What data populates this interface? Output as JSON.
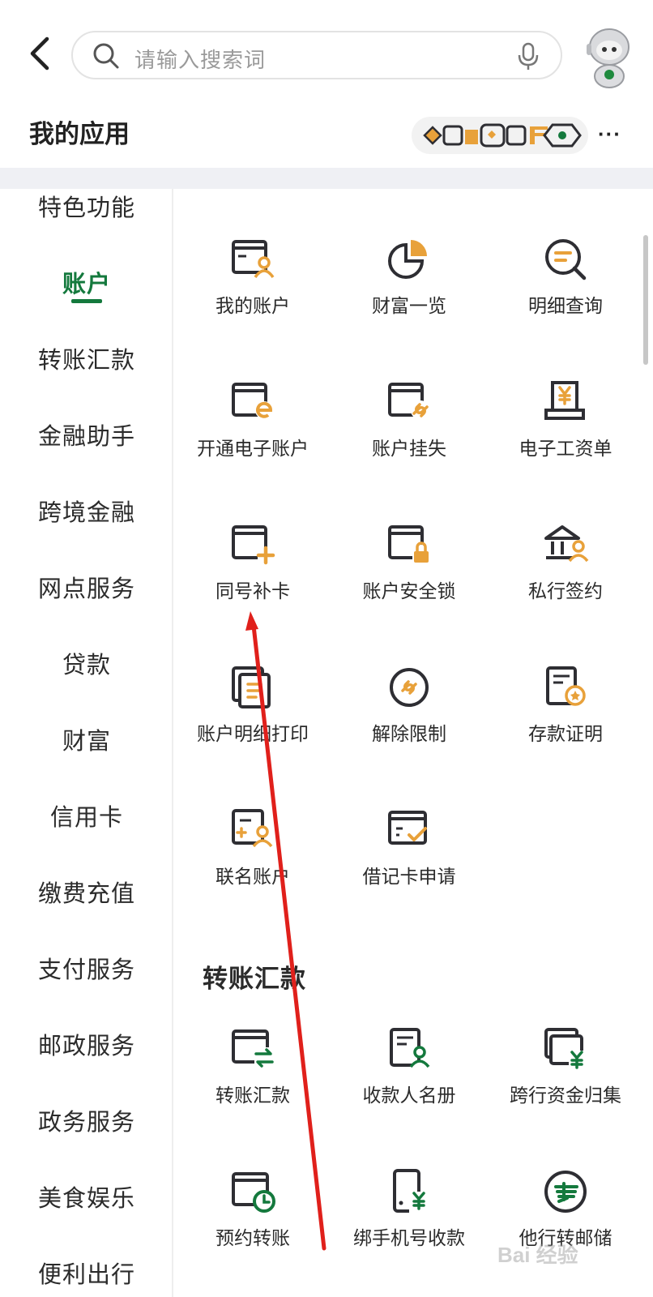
{
  "search": {
    "placeholder": "请输入搜索词"
  },
  "header": {
    "section_title": "我的应用",
    "more_label": "···"
  },
  "sidebar": {
    "items": [
      {
        "label": "特色功能"
      },
      {
        "label": "账户"
      },
      {
        "label": "转账汇款"
      },
      {
        "label": "金融助手"
      },
      {
        "label": "跨境金融"
      },
      {
        "label": "网点服务"
      },
      {
        "label": "贷款"
      },
      {
        "label": "财富"
      },
      {
        "label": "信用卡"
      },
      {
        "label": "缴费充值"
      },
      {
        "label": "支付服务"
      },
      {
        "label": "邮政服务"
      },
      {
        "label": "政务服务"
      },
      {
        "label": "美食娱乐"
      },
      {
        "label": "便利出行"
      }
    ],
    "active": "账户"
  },
  "account_group": {
    "items": [
      {
        "label": "我的账户",
        "icon": "account-card-icon"
      },
      {
        "label": "财富一览",
        "icon": "pie-chart-icon"
      },
      {
        "label": "明细查询",
        "icon": "search-detail-icon"
      },
      {
        "label": "开通电子账户",
        "icon": "e-account-icon"
      },
      {
        "label": "账户挂失",
        "icon": "card-link-icon"
      },
      {
        "label": "电子工资单",
        "icon": "payslip-icon"
      },
      {
        "label": "同号补卡",
        "icon": "card-add-icon"
      },
      {
        "label": "账户安全锁",
        "icon": "card-lock-icon"
      },
      {
        "label": "私行签约",
        "icon": "private-bank-icon"
      },
      {
        "label": "账户明细打印",
        "icon": "print-detail-icon"
      },
      {
        "label": "解除限制",
        "icon": "unlock-link-icon"
      },
      {
        "label": "存款证明",
        "icon": "deposit-certificate-icon"
      },
      {
        "label": "联名账户",
        "icon": "joint-account-icon"
      },
      {
        "label": "借记卡申请",
        "icon": "debit-card-apply-icon"
      }
    ]
  },
  "transfer_group": {
    "title": "转账汇款",
    "items": [
      {
        "label": "转账汇款",
        "icon": "transfer-icon"
      },
      {
        "label": "收款人名册",
        "icon": "payee-list-icon"
      },
      {
        "label": "跨行资金归集",
        "icon": "fund-collect-icon"
      },
      {
        "label": "预约转账",
        "icon": "scheduled-transfer-icon"
      },
      {
        "label": "绑手机号收款",
        "icon": "phone-receive-icon"
      },
      {
        "label": "他行转邮储",
        "icon": "to-postal-icon"
      }
    ]
  },
  "watermark": {
    "text": "Bai 经验"
  },
  "colors": {
    "primary_green": "#14793d",
    "accent_orange": "#e8a13a",
    "icon_dark": "#2e2e33",
    "band_gray": "#eff0f4",
    "annotation_red": "#e0201b"
  }
}
